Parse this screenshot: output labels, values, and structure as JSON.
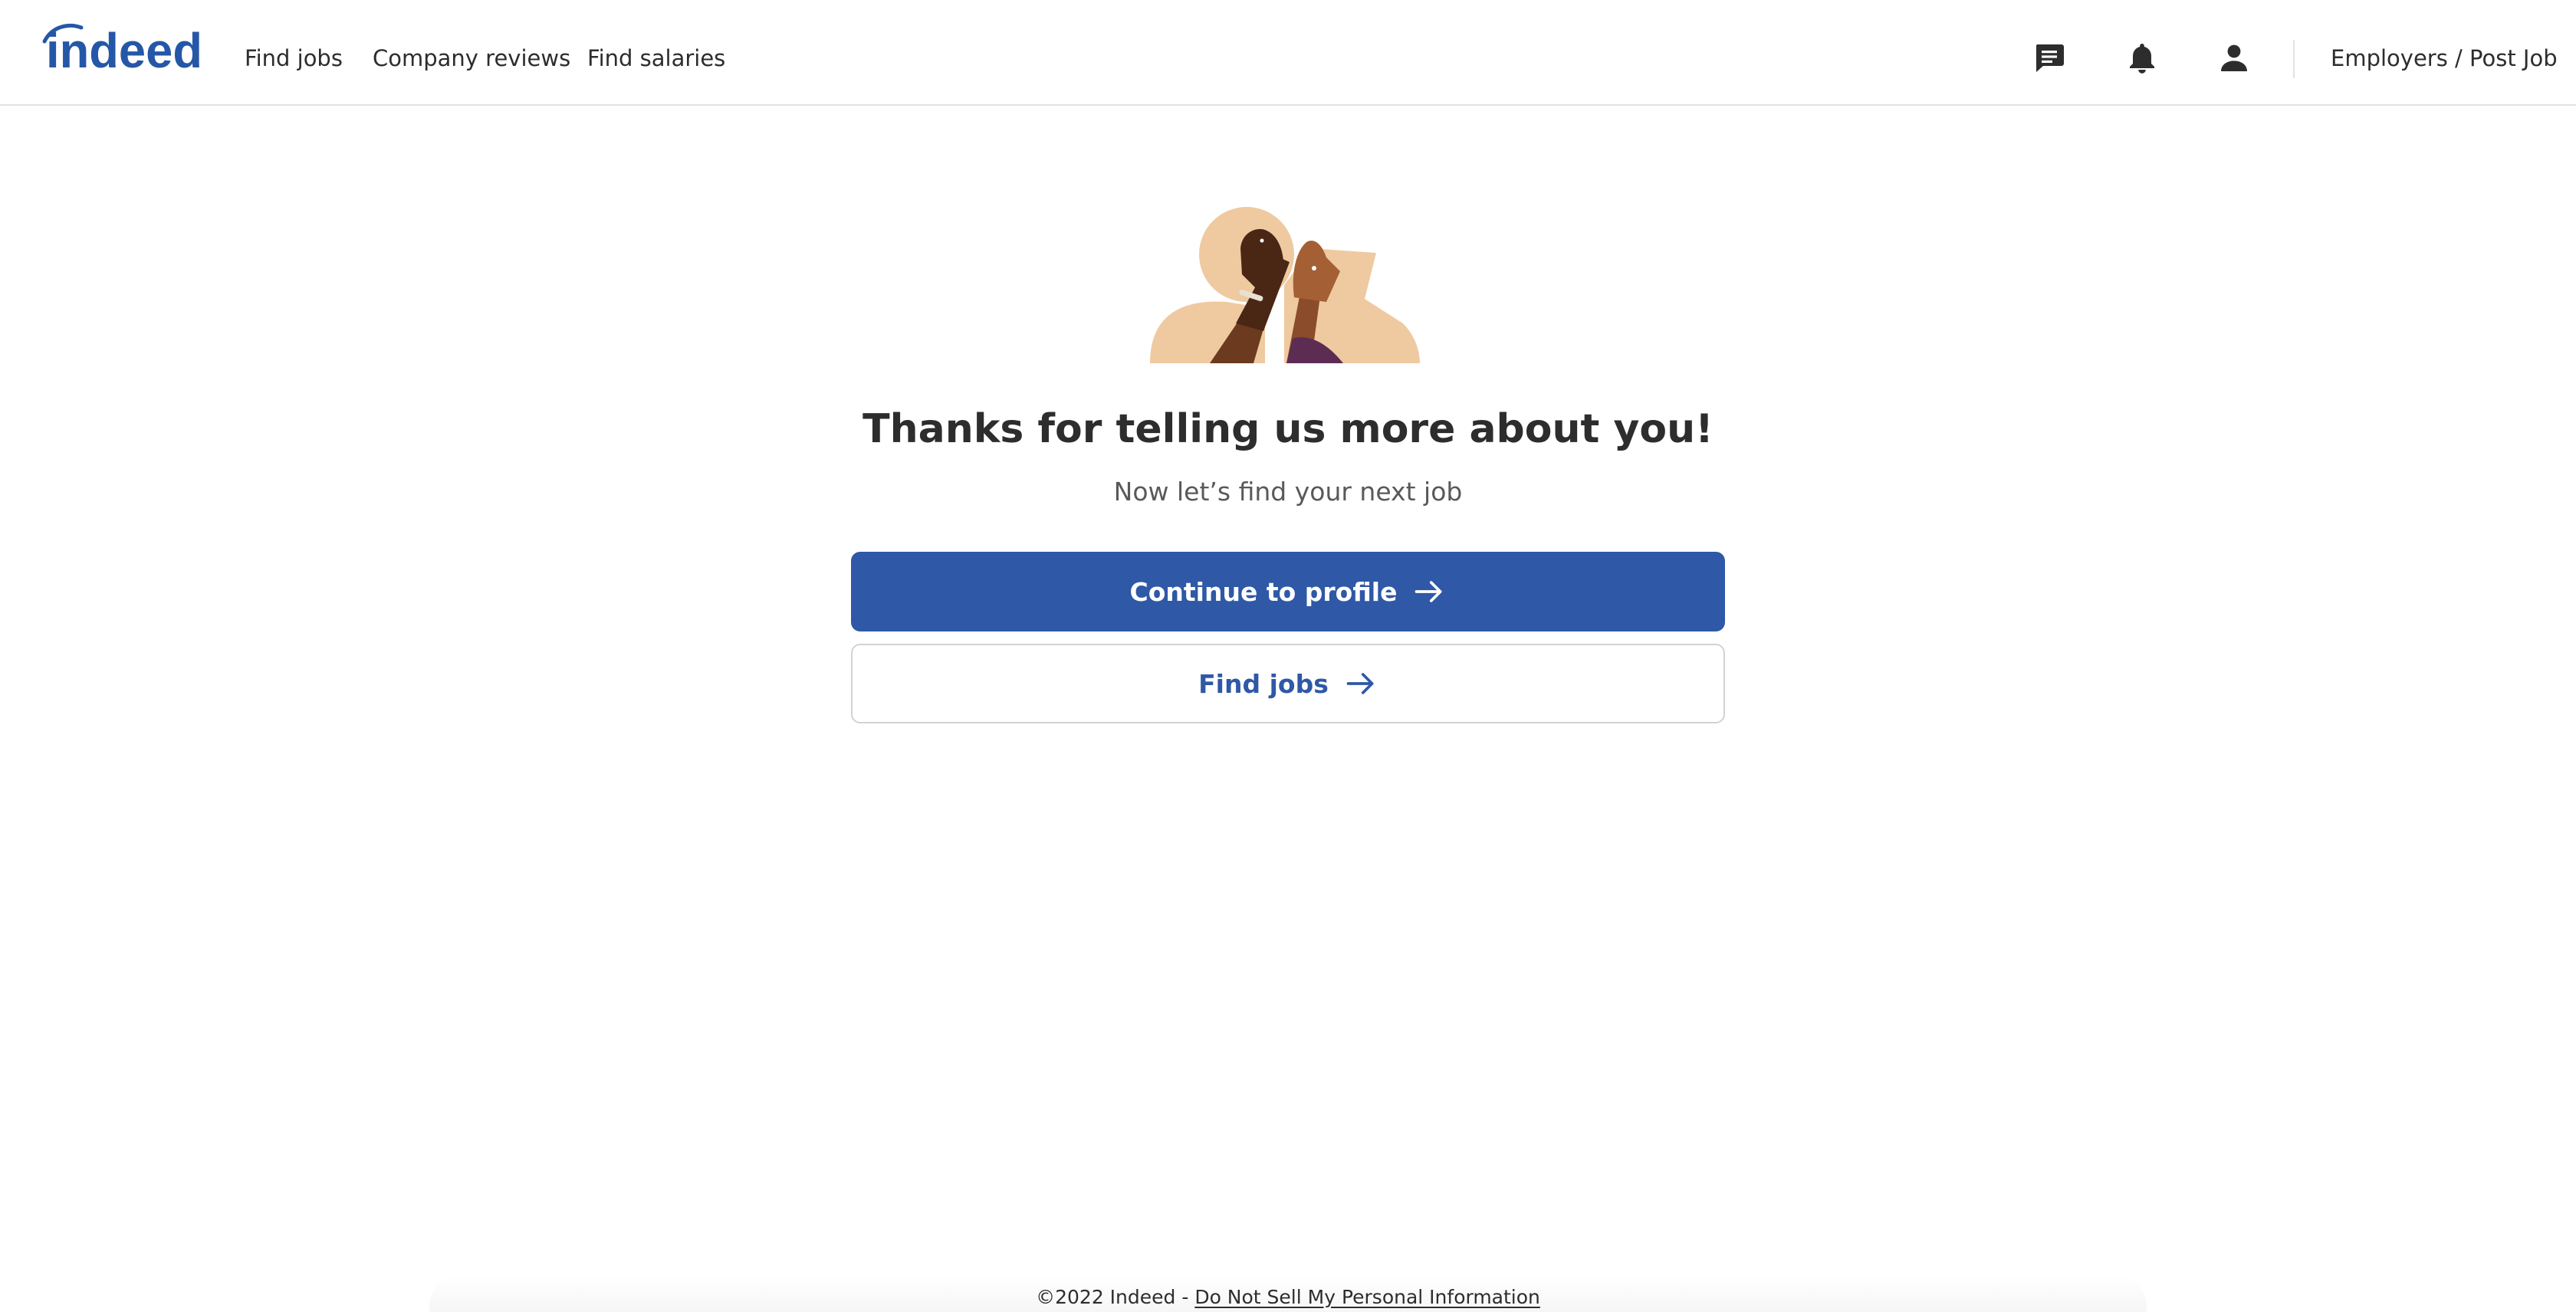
{
  "header": {
    "logo_text": "indeed",
    "nav": [
      {
        "label": "Find jobs"
      },
      {
        "label": "Company reviews"
      },
      {
        "label": "Find salaries"
      }
    ],
    "icons": [
      "messages-icon",
      "notifications-bell-icon",
      "account-person-icon"
    ],
    "employers_label": "Employers / Post Job"
  },
  "main": {
    "illustration": "high-five-hands-illustration",
    "headline": "Thanks for telling us more about you!",
    "subheadline": "Now let’s find your next job",
    "primary_button": {
      "label": "Continue to profile",
      "icon": "arrow-right-icon"
    },
    "secondary_button": {
      "label": "Find jobs",
      "icon": "arrow-right-icon"
    }
  },
  "footer": {
    "copyright": "©2022 Indeed - ",
    "privacy_link": "Do Not Sell My Personal Information"
  },
  "colors": {
    "brand_blue": "#2f58a6",
    "logo_blue": "#2557a7",
    "text": "#2d2d2d",
    "muted_text": "#595959",
    "border": "#e4e2e0"
  }
}
